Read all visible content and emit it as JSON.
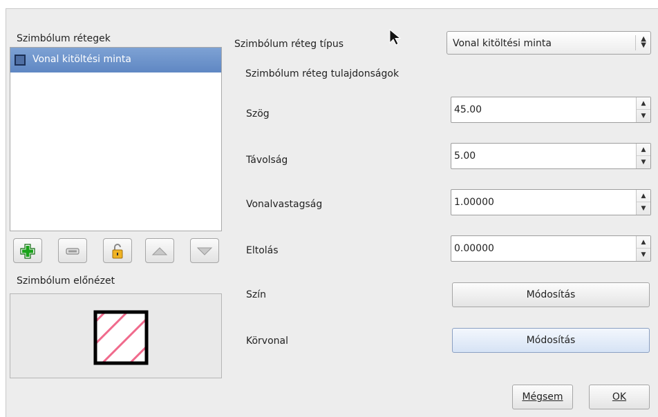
{
  "left_panel": {
    "layers_title": "Szimbólum rétegek",
    "layers": [
      {
        "label": "Vonal kitöltési minta",
        "selected": true
      }
    ],
    "tool_buttons": [
      {
        "icon": "add-icon"
      },
      {
        "icon": "remove-icon"
      },
      {
        "icon": "lock-icon"
      },
      {
        "icon": "move-up-icon"
      },
      {
        "icon": "move-down-icon"
      }
    ],
    "preview_title": "Szimbólum előnézet"
  },
  "right_panel": {
    "type_label": "Szimbólum réteg típus",
    "type_value": "Vonal kitöltési minta",
    "properties_title": "Szimbólum réteg tulajdonságok",
    "angle": {
      "label": "Szög",
      "value": "45.00"
    },
    "distance": {
      "label": "Távolság",
      "value": "5.00"
    },
    "line_width": {
      "label": "Vonalvastagság",
      "value": "1.00000"
    },
    "offset": {
      "label": "Eltolás",
      "value": "0.00000"
    },
    "color": {
      "label": "Szín",
      "button": "Módosítás"
    },
    "outline": {
      "label": "Körvonal",
      "button": "Módosítás"
    }
  },
  "footer": {
    "cancel": "Mégsem",
    "ok": "OK"
  },
  "colors": {
    "selection": "#6b93cb",
    "hatch": "#f06a8c",
    "add_green": "#1aa31a",
    "lock_gold": "#f0b323"
  }
}
